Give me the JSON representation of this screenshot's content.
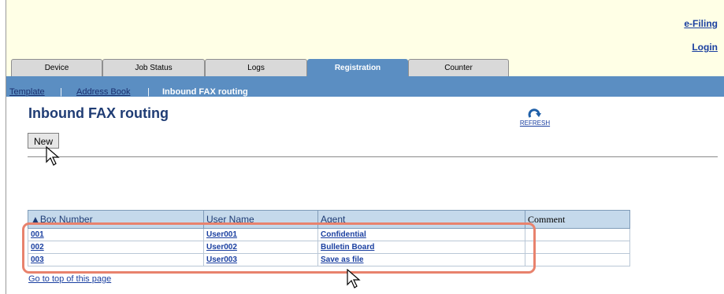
{
  "header": {
    "efiling_link": "e-Filing",
    "login_link": "Login"
  },
  "tabs": [
    {
      "label": "Device",
      "active": false
    },
    {
      "label": "Job Status",
      "active": false
    },
    {
      "label": "Logs",
      "active": false
    },
    {
      "label": "Registration",
      "active": true
    },
    {
      "label": "Counter",
      "active": false
    }
  ],
  "subnav": {
    "template": "Template",
    "sep1": "|",
    "address_book": "Address Book",
    "sep2": "|",
    "current": "Inbound FAX routing"
  },
  "page": {
    "title": "Inbound FAX routing",
    "refresh_label": "REFRESH",
    "new_button": "New"
  },
  "table": {
    "columns": [
      "▲Box Number",
      "User Name",
      "Agent",
      "Comment"
    ],
    "rows": [
      {
        "box": "001",
        "user": "User001",
        "agent": "Confidential",
        "comment": ""
      },
      {
        "box": "002",
        "user": "User002",
        "agent": "Bulletin Board",
        "comment": ""
      },
      {
        "box": "003",
        "user": "User003",
        "agent": "Save as file",
        "comment": ""
      }
    ]
  },
  "footer": {
    "go_to_top": "Go to top of this page"
  },
  "colors": {
    "accent": "#5b8ec2",
    "header_bg": "#ffffe6",
    "highlight": "#e8826d"
  }
}
